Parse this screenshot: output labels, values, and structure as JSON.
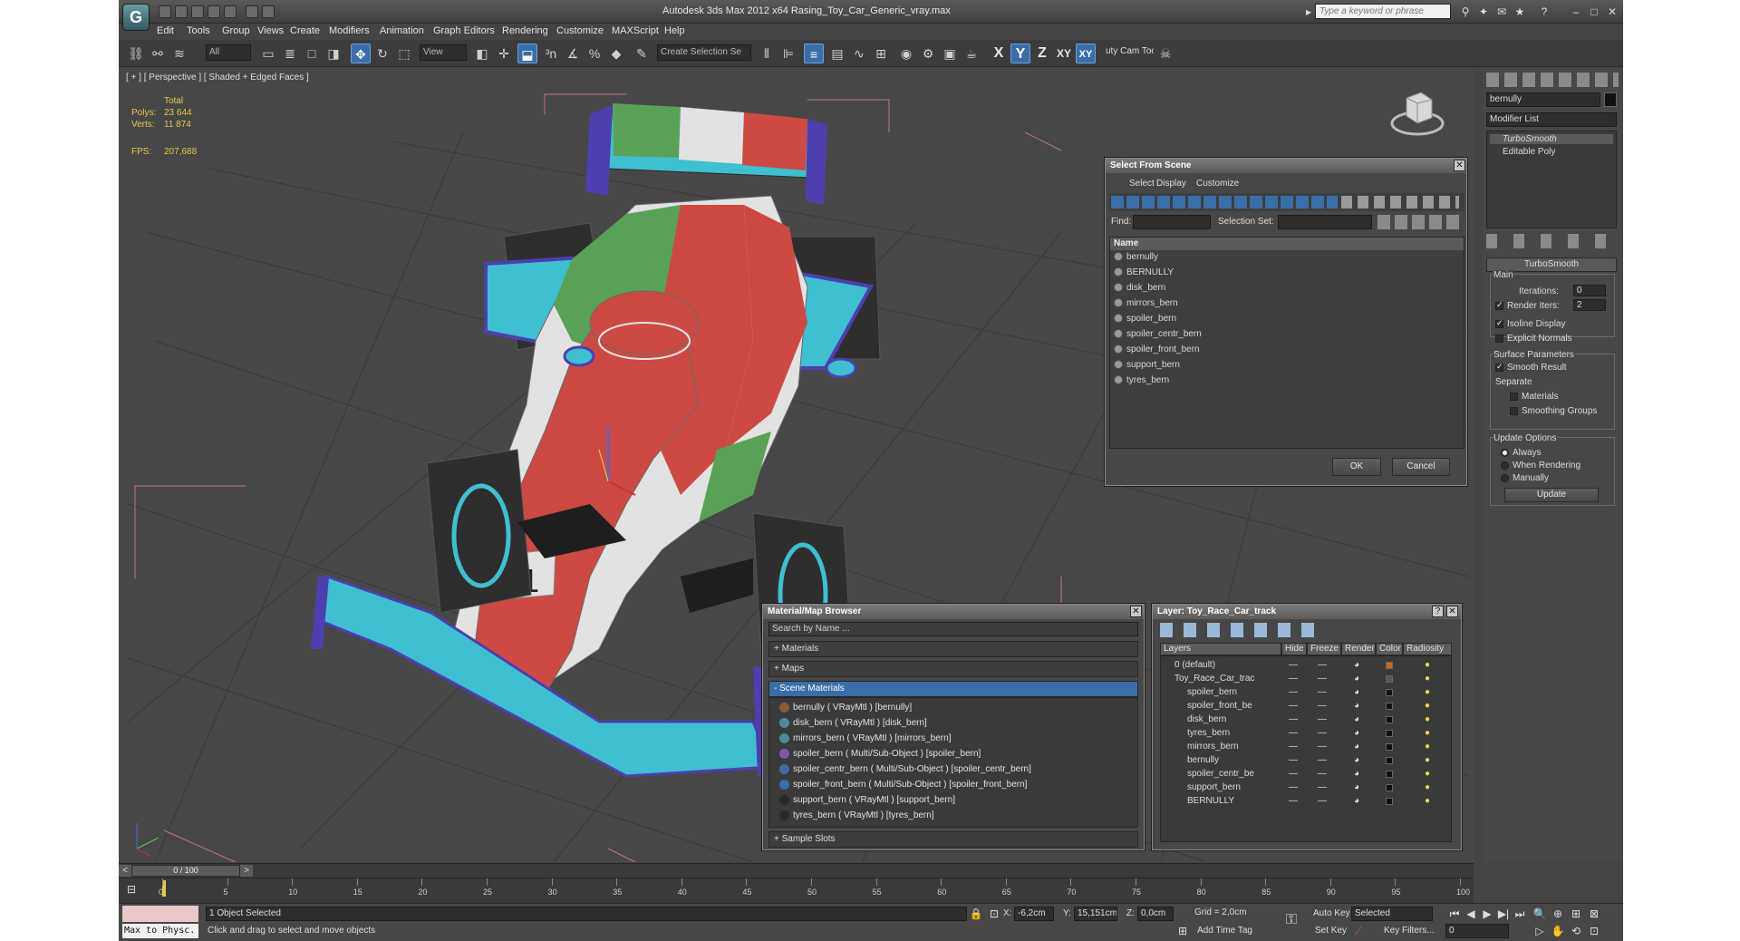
{
  "window": {
    "title": "Autodesk 3ds Max  2012 x64     Rasing_Toy_Car_Generic_vray.max",
    "search_placeholder": "Type a keyword or phrase",
    "logo_icon": "3dsmax-logo-icon"
  },
  "menu": [
    "Edit",
    "Tools",
    "Group",
    "Views",
    "Create",
    "Modifiers",
    "Animation",
    "Graph Editors",
    "Rendering",
    "Customize",
    "MAXScript",
    "Help"
  ],
  "toolbar": {
    "filter_all": "All",
    "ref_coord": "View",
    "selection_set_placeholder": "Create Selection Se",
    "axes": [
      "X",
      "Y",
      "Z",
      "XY",
      "XY"
    ],
    "active_axis_index": 1,
    "cam_tool": "uty Cam Tool"
  },
  "viewport": {
    "label": "[ + ] [ Perspective ] [ Shaded + Edged Faces ]",
    "stats": {
      "total_label": "Total",
      "polys_label": "Polys:",
      "polys_value": "23 644",
      "verts_label": "Verts:",
      "verts_value": "11 874",
      "fps_label": "FPS:",
      "fps_value": "207,688"
    },
    "car_number": "1",
    "colors": {
      "red": "#cc4a43",
      "white": "#e2e2e2",
      "green": "#5aa158",
      "cyan": "#3fbfd0",
      "purple": "#4c3fb0",
      "tyre": "#2e2e2e",
      "grid": "#3a3a3a"
    }
  },
  "select_from_scene": {
    "title": "Select From Scene",
    "menus": [
      "Select",
      "Display",
      "Customize"
    ],
    "find_label": "Find:",
    "selection_set_label": "Selection Set:",
    "column_name": "Name",
    "items": [
      "bernully",
      "BERNULLY",
      "disk_bern",
      "mirrors_bern",
      "spoiler_bern",
      "spoiler_centr_bern",
      "spoiler_front_bern",
      "support_bern",
      "tyres_bern"
    ],
    "ok": "OK",
    "cancel": "Cancel"
  },
  "material_browser": {
    "title": "Material/Map Browser",
    "search_placeholder": "Search by Name ...",
    "sections": {
      "materials": "+ Materials",
      "maps": "+ Maps",
      "scene_materials": "- Scene Materials",
      "sample_slots": "+ Sample Slots"
    },
    "scene_materials": [
      {
        "text": "bernully  ( VRayMtl )  [bernully]",
        "icon": "vraymtl-icon"
      },
      {
        "text": "disk_bern  ( VRayMtl )  [disk_bern]",
        "icon": "vraymtl-icon"
      },
      {
        "text": "mirrors_bern  ( VRayMtl )  [mirrors_bern]",
        "icon": "vraymtl-icon"
      },
      {
        "text": "spoiler_bern  ( Multi/Sub-Object )  [spoiler_bern]",
        "icon": "multisub-icon"
      },
      {
        "text": "spoiler_centr_bern  ( Multi/Sub-Object )  [spoiler_centr_bern]",
        "icon": "multisub-icon"
      },
      {
        "text": "spoiler_front_bern  ( Multi/Sub-Object )  [spoiler_front_bern]",
        "icon": "multisub-icon"
      },
      {
        "text": "support_bern  ( VRayMtl )  [support_bern]",
        "icon": "vraymtl-icon"
      },
      {
        "text": "tyres_bern  ( VRayMtl )  [tyres_bern]",
        "icon": "vraymtl-icon"
      }
    ]
  },
  "layer_dialog": {
    "title": "Layer: Toy_Race_Car_track",
    "help": "?",
    "columns": [
      "Layers",
      "Hide",
      "Freeze",
      "Render",
      "Color",
      "Radiosity"
    ],
    "rows": [
      {
        "name": "0 (default)",
        "indent": 1,
        "color": "#c8661e"
      },
      {
        "name": "Toy_Race_Car_trac",
        "indent": 1,
        "color": "#555555"
      },
      {
        "name": "spoiler_bern",
        "indent": 2,
        "color": "#111111"
      },
      {
        "name": "spoiler_front_be",
        "indent": 2,
        "color": "#111111"
      },
      {
        "name": "disk_bern",
        "indent": 2,
        "color": "#111111"
      },
      {
        "name": "tyres_bern",
        "indent": 2,
        "color": "#111111"
      },
      {
        "name": "mirrors_bern",
        "indent": 2,
        "color": "#111111"
      },
      {
        "name": "bernully",
        "indent": 2,
        "color": "#111111"
      },
      {
        "name": "spoiler_centr_be",
        "indent": 2,
        "color": "#111111"
      },
      {
        "name": "support_bern",
        "indent": 2,
        "color": "#111111"
      },
      {
        "name": "BERNULLY",
        "indent": 2,
        "color": "#111111"
      }
    ]
  },
  "command_panel": {
    "object_name": "bernully",
    "object_color": "#111111",
    "modifier_list": "Modifier List",
    "stack": [
      "TurboSmooth",
      "Editable Poly"
    ],
    "rollout_title": "TurboSmooth",
    "main_label": "Main",
    "iterations_label": "Iterations:",
    "iterations_value": "0",
    "render_iters_label": "Render Iters:",
    "render_iters_value": "2",
    "isoline_display": "Isoline Display",
    "explicit_normals": "Explicit Normals",
    "surface_params": "Surface Parameters",
    "smooth_result": "Smooth Result",
    "separate": "Separate",
    "materials": "Materials",
    "smoothing_groups": "Smoothing Groups",
    "update_options": "Update Options",
    "always": "Always",
    "when_rendering": "When Rendering",
    "manually": "Manually",
    "update_button": "Update",
    "checked": {
      "isoline": true,
      "explicit": false,
      "smooth": true,
      "materials": false,
      "smoothing_groups": false,
      "render_iters": true
    }
  },
  "timeline": {
    "frame": "0 / 100",
    "ticks": [
      "0",
      "5",
      "10",
      "15",
      "20",
      "25",
      "30",
      "35",
      "40",
      "45",
      "50",
      "55",
      "60",
      "65",
      "70",
      "75",
      "80",
      "85",
      "90",
      "95",
      "100"
    ]
  },
  "status": {
    "script_label": "Max to Physc.",
    "selected": "1 Object Selected",
    "prompt": "Click and drag to select and move objects",
    "x_label": "X:",
    "x_value": "-6,2cm",
    "y_label": "Y:",
    "y_value": "15,151cm",
    "z_label": "Z:",
    "z_value": "0,0cm",
    "grid": "Grid = 2,0cm",
    "add_time_tag": "Add Time Tag",
    "auto_key": "Auto Key",
    "set_key": "Set Key",
    "key_mode": "Selected",
    "key_filters": "Key Filters...",
    "frame_value": "0"
  }
}
